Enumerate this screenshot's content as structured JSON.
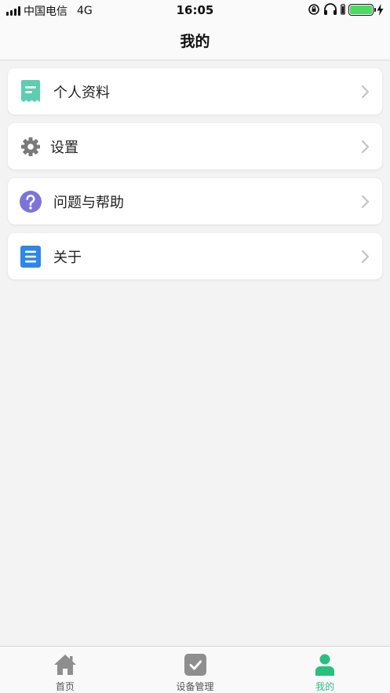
{
  "status_bar": {
    "carrier": "中国电信",
    "network": "4G",
    "time": "16:05"
  },
  "nav": {
    "title": "我的"
  },
  "menu": {
    "items": [
      {
        "label": "个人资料",
        "icon": "profile-doc-icon",
        "color": "#5ccdb0"
      },
      {
        "label": "设置",
        "icon": "gear-icon",
        "color": "#7a7a7a"
      },
      {
        "label": "问题与帮助",
        "icon": "question-icon",
        "color": "#7e74d8"
      },
      {
        "label": "关于",
        "icon": "list-doc-icon",
        "color": "#2e86e6"
      }
    ]
  },
  "tabs": [
    {
      "label": "首页",
      "icon": "home-icon",
      "active": false
    },
    {
      "label": "设备管理",
      "icon": "check-square-icon",
      "active": false
    },
    {
      "label": "我的",
      "icon": "user-icon",
      "active": true
    }
  ],
  "colors": {
    "accent": "#2bbf7e",
    "inactive_icon": "#8e8e8e",
    "battery": "#4cd964"
  }
}
